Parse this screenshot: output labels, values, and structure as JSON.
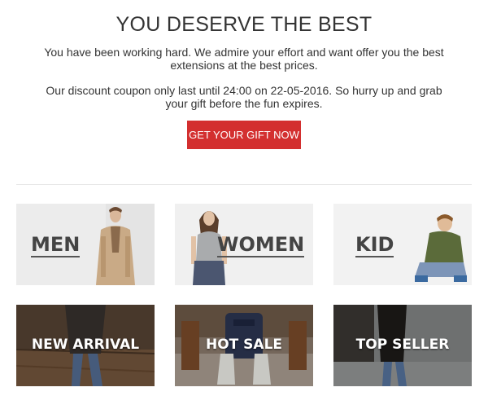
{
  "hero": {
    "title": "YOU DESERVE THE BEST",
    "paragraph1": "You have been working hard. We admire your effort and want offer you the best extensions at the best prices.",
    "paragraph2": "Our discount coupon only last until 24:00 on 22-05-2016. So hurry up and grab your gift before the fun expires.",
    "cta_label": "GET YOUR GIFT NOW"
  },
  "colors": {
    "accent": "#d32f2f",
    "text": "#333333"
  },
  "categories": [
    {
      "label": "MEN"
    },
    {
      "label": "WOMEN"
    },
    {
      "label": "KID"
    }
  ],
  "collections": [
    {
      "label": "NEW ARRIVAL"
    },
    {
      "label": "HOT SALE"
    },
    {
      "label": "TOP SELLER"
    }
  ]
}
